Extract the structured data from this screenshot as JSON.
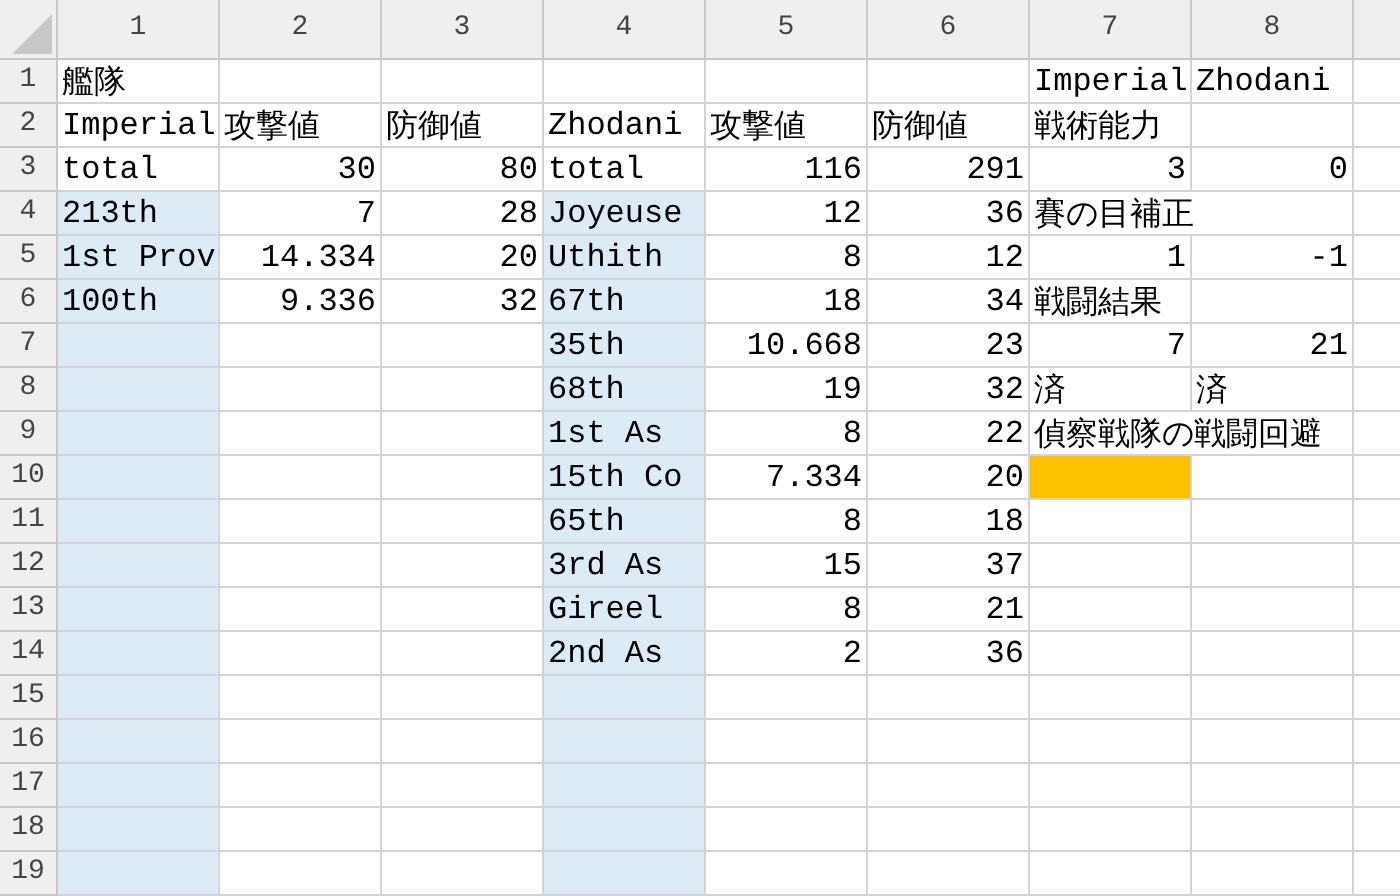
{
  "columns": [
    "1",
    "2",
    "3",
    "4",
    "5",
    "6",
    "7",
    "8"
  ],
  "rows": [
    {
      "header": "1",
      "cells": [
        {
          "text": "艦隊",
          "kind": "text"
        },
        null,
        null,
        null,
        null,
        null,
        {
          "text": "Imperial",
          "kind": "text"
        },
        {
          "text": "Zhodani",
          "kind": "text"
        }
      ]
    },
    {
      "header": "2",
      "cells": [
        {
          "text": "Imperial",
          "kind": "text"
        },
        {
          "text": "攻撃値",
          "kind": "text"
        },
        {
          "text": "防御値",
          "kind": "text"
        },
        {
          "text": "Zhodani",
          "kind": "text"
        },
        {
          "text": "攻撃値",
          "kind": "text"
        },
        {
          "text": "防御値",
          "kind": "text"
        },
        {
          "text": "戦術能力",
          "kind": "text"
        },
        null
      ]
    },
    {
      "header": "3",
      "cells": [
        {
          "text": "total",
          "kind": "text"
        },
        {
          "text": "30",
          "kind": "number"
        },
        {
          "text": "80",
          "kind": "number"
        },
        {
          "text": "total",
          "kind": "text"
        },
        {
          "text": "116",
          "kind": "number"
        },
        {
          "text": "291",
          "kind": "number"
        },
        {
          "text": "3",
          "kind": "number"
        },
        {
          "text": "0",
          "kind": "number"
        }
      ]
    },
    {
      "header": "4",
      "cells": [
        {
          "text": "213th",
          "kind": "text",
          "color": "#ddebf7"
        },
        {
          "text": "7",
          "kind": "number"
        },
        {
          "text": "28",
          "kind": "number"
        },
        {
          "text": "Joyeuse",
          "kind": "text",
          "color": "#ddebf7"
        },
        {
          "text": "12",
          "kind": "number"
        },
        {
          "text": "36",
          "kind": "number"
        },
        {
          "text": "賽の目補正",
          "kind": "text"
        },
        null
      ]
    },
    {
      "header": "5",
      "cells": [
        {
          "text": "1st Prov",
          "kind": "text",
          "color": "#ddebf7"
        },
        {
          "text": "14.334",
          "kind": "number"
        },
        {
          "text": "20",
          "kind": "number"
        },
        {
          "text": "Uthith",
          "kind": "text",
          "color": "#ddebf7"
        },
        {
          "text": "8",
          "kind": "number"
        },
        {
          "text": "12",
          "kind": "number"
        },
        {
          "text": "1",
          "kind": "number"
        },
        {
          "text": "-1",
          "kind": "number"
        }
      ]
    },
    {
      "header": "6",
      "cells": [
        {
          "text": "100th",
          "kind": "text",
          "color": "#ddebf7"
        },
        {
          "text": "9.336",
          "kind": "number"
        },
        {
          "text": "32",
          "kind": "number"
        },
        {
          "text": "67th",
          "kind": "text",
          "color": "#ddebf7"
        },
        {
          "text": "18",
          "kind": "number"
        },
        {
          "text": "34",
          "kind": "number"
        },
        {
          "text": "戦闘結果",
          "kind": "text"
        },
        null
      ]
    },
    {
      "header": "7",
      "cells": [
        {
          "color": "#ddebf7"
        },
        null,
        null,
        {
          "text": "35th",
          "kind": "text",
          "color": "#ddebf7"
        },
        {
          "text": "10.668",
          "kind": "number"
        },
        {
          "text": "23",
          "kind": "number"
        },
        {
          "text": "7",
          "kind": "number"
        },
        {
          "text": "21",
          "kind": "number"
        }
      ]
    },
    {
      "header": "8",
      "cells": [
        {
          "color": "#ddebf7"
        },
        null,
        null,
        {
          "text": "68th",
          "kind": "text",
          "color": "#ddebf7"
        },
        {
          "text": "19",
          "kind": "number"
        },
        {
          "text": "32",
          "kind": "number"
        },
        {
          "text": "済",
          "kind": "text"
        },
        {
          "text": "済",
          "kind": "text"
        }
      ]
    },
    {
      "header": "9",
      "cells": [
        {
          "color": "#ddebf7"
        },
        null,
        null,
        {
          "text": "1st As",
          "kind": "text",
          "color": "#ddebf7"
        },
        {
          "text": "8",
          "kind": "number"
        },
        {
          "text": "22",
          "kind": "number"
        },
        {
          "text": "偵察戦隊の戦闘回避",
          "kind": "text"
        },
        null
      ]
    },
    {
      "header": "10",
      "cells": [
        {
          "color": "#ddebf7"
        },
        null,
        null,
        {
          "text": "15th Co",
          "kind": "text",
          "color": "#ddebf7"
        },
        {
          "text": "7.334",
          "kind": "number"
        },
        {
          "text": "20",
          "kind": "number"
        },
        {
          "color": "#ffc000"
        },
        null
      ]
    },
    {
      "header": "11",
      "cells": [
        {
          "color": "#ddebf7"
        },
        null,
        null,
        {
          "text": "65th",
          "kind": "text",
          "color": "#ddebf7"
        },
        {
          "text": "8",
          "kind": "number"
        },
        {
          "text": "18",
          "kind": "number"
        },
        null,
        null
      ]
    },
    {
      "header": "12",
      "cells": [
        {
          "color": "#ddebf7"
        },
        null,
        null,
        {
          "text": "3rd As",
          "kind": "text",
          "color": "#ddebf7"
        },
        {
          "text": "15",
          "kind": "number"
        },
        {
          "text": "37",
          "kind": "number"
        },
        null,
        null
      ]
    },
    {
      "header": "13",
      "cells": [
        {
          "color": "#ddebf7"
        },
        null,
        null,
        {
          "text": "Gireel",
          "kind": "text",
          "color": "#ddebf7"
        },
        {
          "text": "8",
          "kind": "number"
        },
        {
          "text": "21",
          "kind": "number"
        },
        null,
        null
      ]
    },
    {
      "header": "14",
      "cells": [
        {
          "color": "#ddebf7"
        },
        null,
        null,
        {
          "text": "2nd As",
          "kind": "text",
          "color": "#ddebf7"
        },
        {
          "text": "2",
          "kind": "number"
        },
        {
          "text": "36",
          "kind": "number"
        },
        null,
        null
      ]
    },
    {
      "header": "15",
      "cells": [
        {
          "color": "#ddebf7"
        },
        null,
        null,
        {
          "color": "#ddebf7"
        },
        null,
        null,
        null,
        null
      ]
    },
    {
      "header": "16",
      "cells": [
        {
          "color": "#ddebf7"
        },
        null,
        null,
        {
          "color": "#ddebf7"
        },
        null,
        null,
        null,
        null
      ]
    },
    {
      "header": "17",
      "cells": [
        {
          "color": "#ddebf7"
        },
        null,
        null,
        {
          "color": "#ddebf7"
        },
        null,
        null,
        null,
        null
      ]
    },
    {
      "header": "18",
      "cells": [
        {
          "color": "#ddebf7"
        },
        null,
        null,
        {
          "color": "#ddebf7"
        },
        null,
        null,
        null,
        null
      ]
    },
    {
      "header": "19",
      "cells": [
        {
          "color": "#ddebf7"
        },
        null,
        null,
        {
          "color": "#ddebf7"
        },
        null,
        null,
        null,
        null
      ]
    }
  ]
}
